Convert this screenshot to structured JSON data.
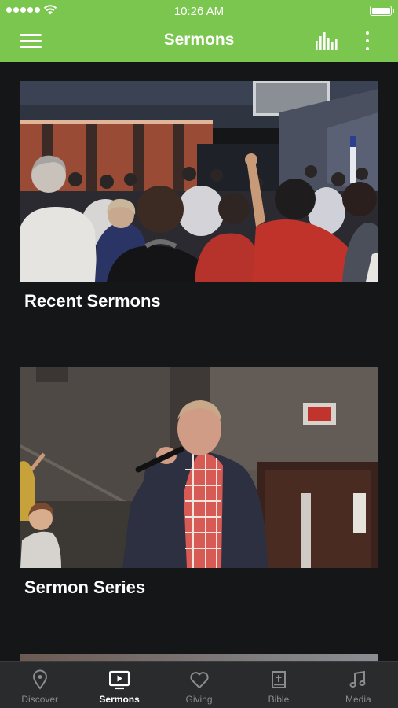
{
  "status_bar": {
    "time": "10:26 AM"
  },
  "nav": {
    "title": "Sermons"
  },
  "cards": [
    {
      "title": "Recent Sermons"
    },
    {
      "title": "Sermon Series"
    }
  ],
  "tabs": [
    {
      "label": "Discover",
      "icon": "location-pin-icon"
    },
    {
      "label": "Sermons",
      "icon": "tv-play-icon",
      "active": true
    },
    {
      "label": "Giving",
      "icon": "heart-icon"
    },
    {
      "label": "Bible",
      "icon": "bible-icon"
    },
    {
      "label": "Media",
      "icon": "music-note-icon"
    }
  ],
  "colors": {
    "header_green": "#7ac64f",
    "background": "#151617",
    "tab_bar": "#2a2b2d",
    "tab_inactive": "#8b8c8e"
  }
}
